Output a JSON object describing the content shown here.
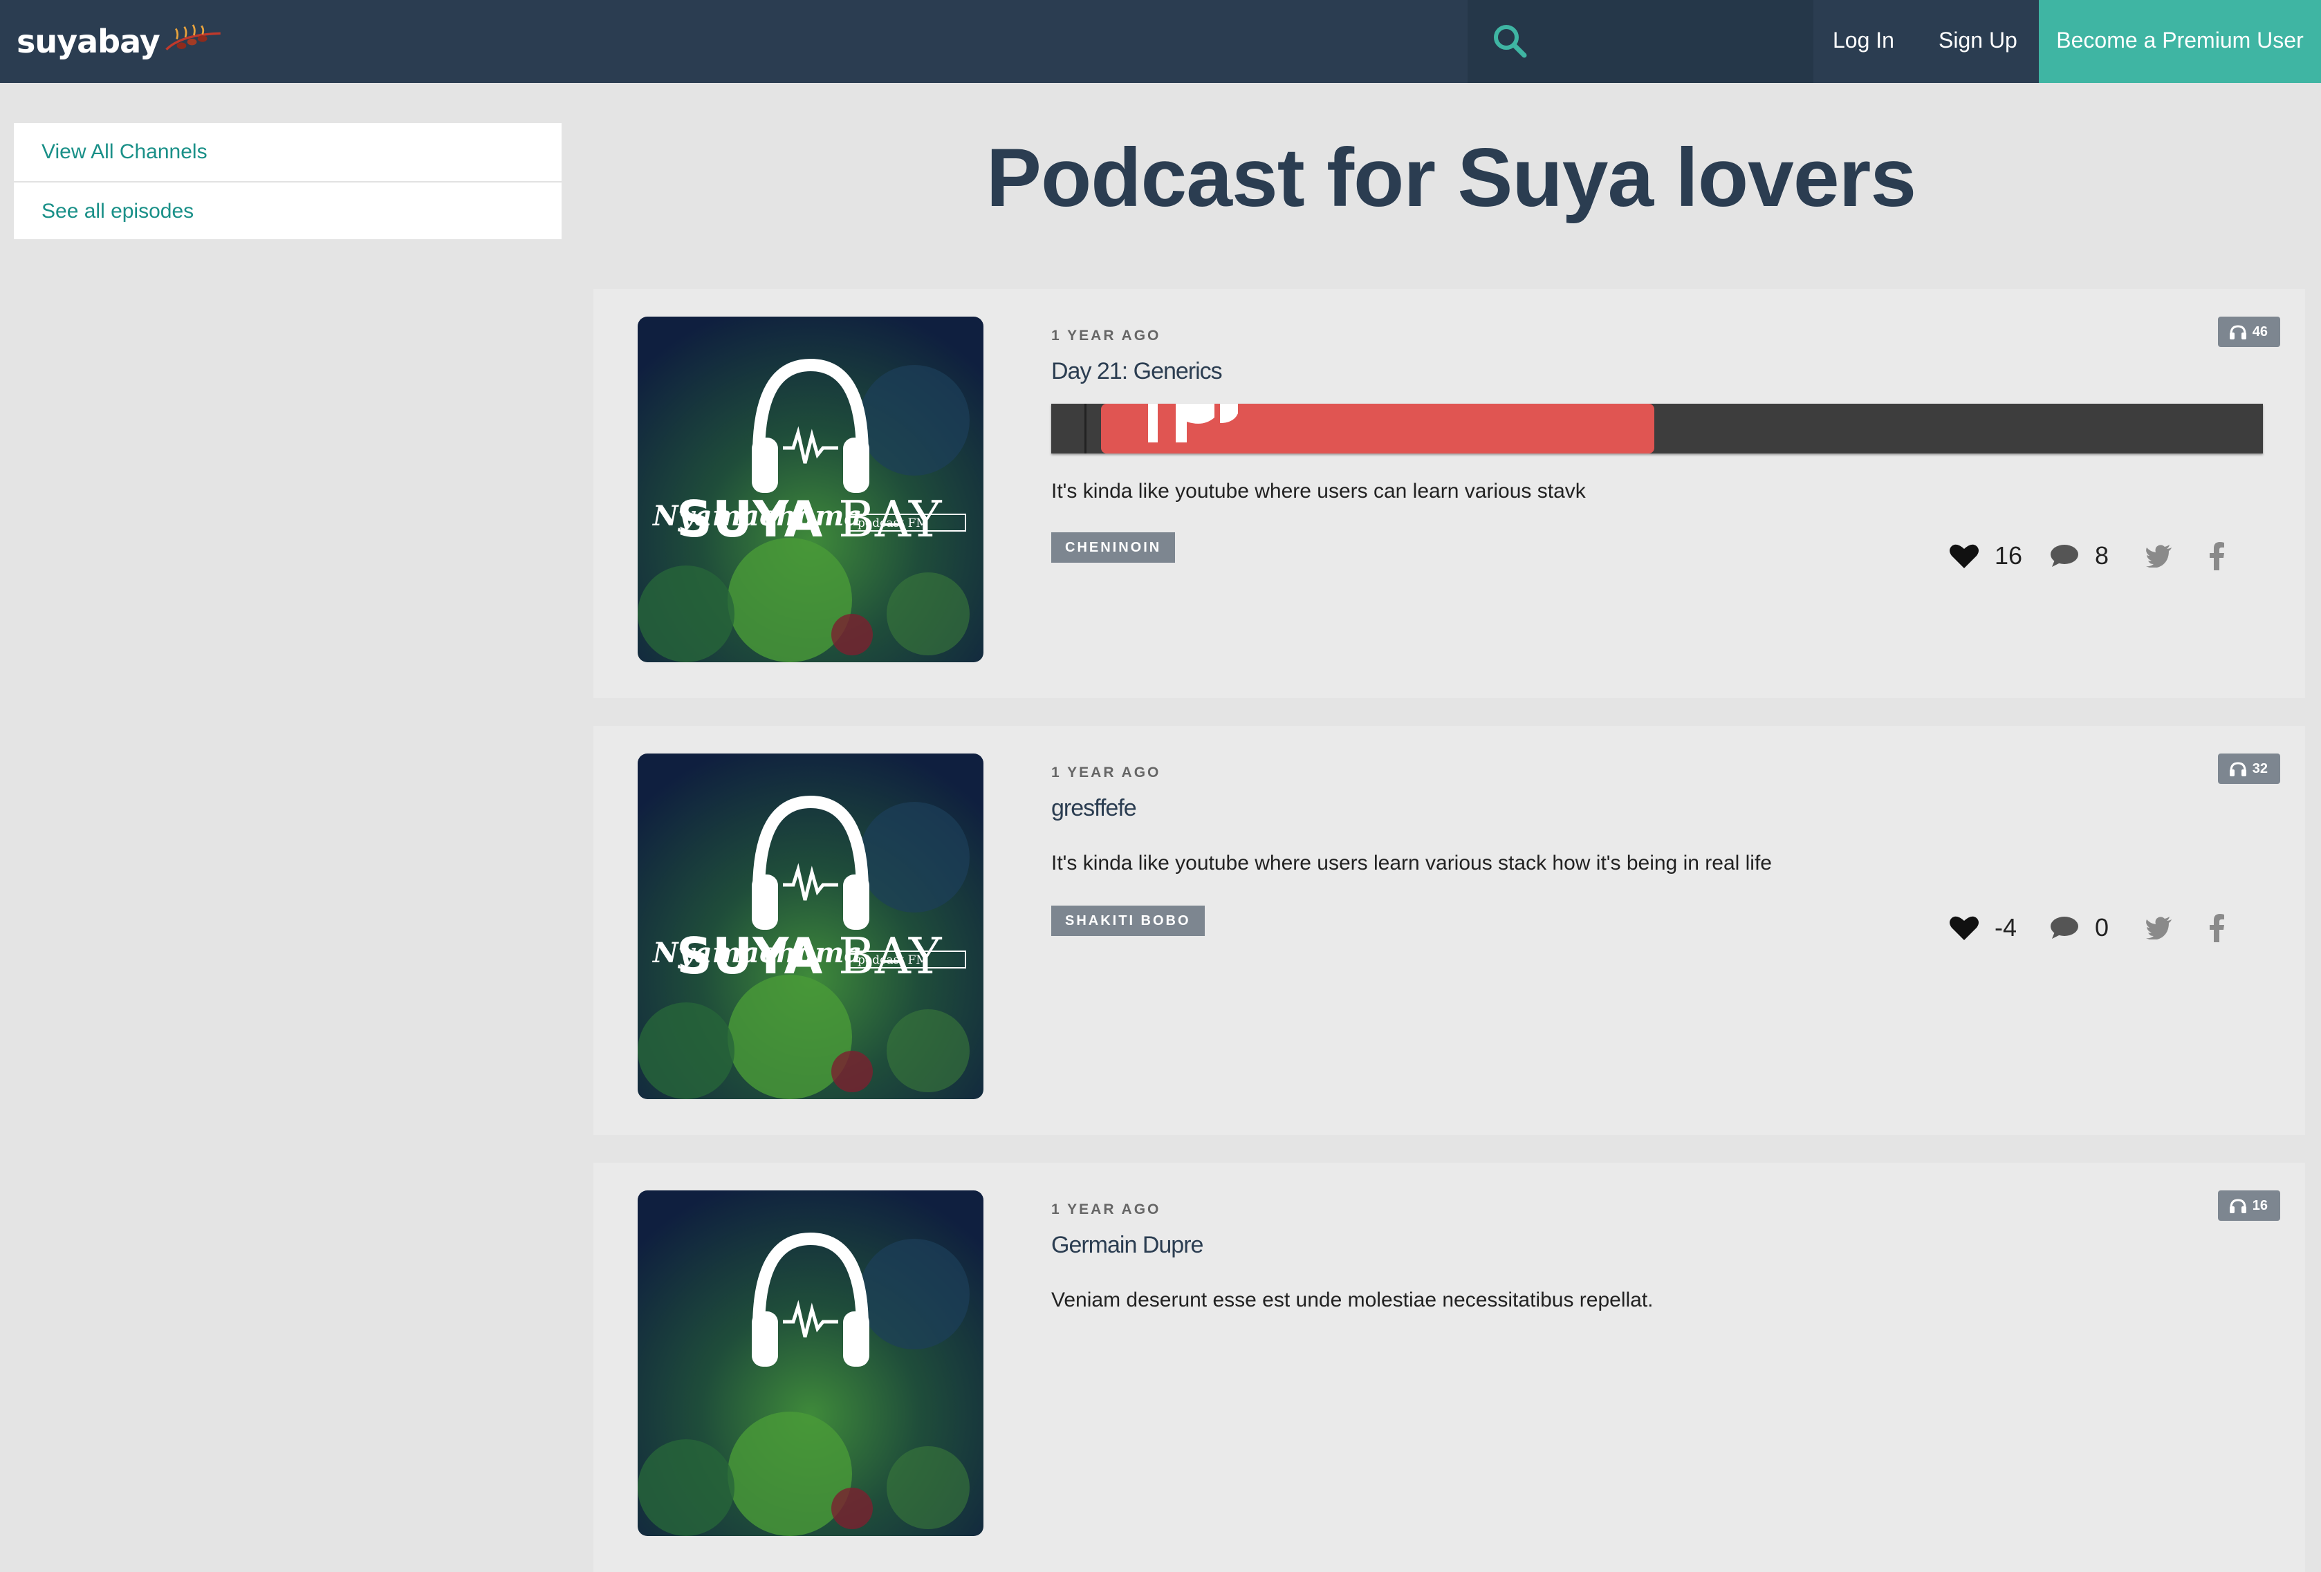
{
  "header": {
    "logo_text": "suyabay",
    "nav": {
      "login": "Log In",
      "signup": "Sign Up",
      "premium": "Become a Premium User"
    },
    "colors": {
      "bar": "#2b3d51",
      "accent": "#3fb5a3"
    }
  },
  "sidebar": {
    "items": [
      {
        "label": "View All Channels"
      },
      {
        "label": "See all episodes"
      }
    ]
  },
  "page": {
    "title": "Podcast for Suya lovers"
  },
  "cover": {
    "brand": "SUYA",
    "brand2": "BAY",
    "sub": "Nyamachoma",
    "tag": "podcast FM"
  },
  "episodes": [
    {
      "time": "1 YEAR AGO",
      "title": "Day 21: Generics",
      "description": "It's kinda like youtube where users can learn various stavk",
      "author": "CHENINOIN",
      "listens": "46",
      "likes": "16",
      "comments": "8",
      "player_progress": 0.5
    },
    {
      "time": "1 YEAR AGO",
      "title": "gresffefe",
      "description": "It's kinda like youtube where users learn various stack how it's being in real life",
      "author": "SHAKITI BOBO",
      "listens": "32",
      "likes": "-4",
      "comments": "0"
    },
    {
      "time": "1 YEAR AGO",
      "title": "Germain Dupre",
      "description": "Veniam deserunt esse est unde molestiae necessitatibus repellat.",
      "listens": "16"
    }
  ]
}
